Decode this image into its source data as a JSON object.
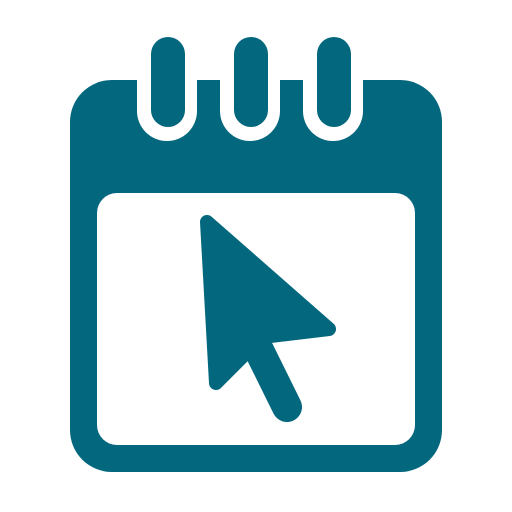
{
  "icon": {
    "name": "calendar-click-icon",
    "primary_color": "#03677d",
    "background_color": "#ffffff"
  }
}
